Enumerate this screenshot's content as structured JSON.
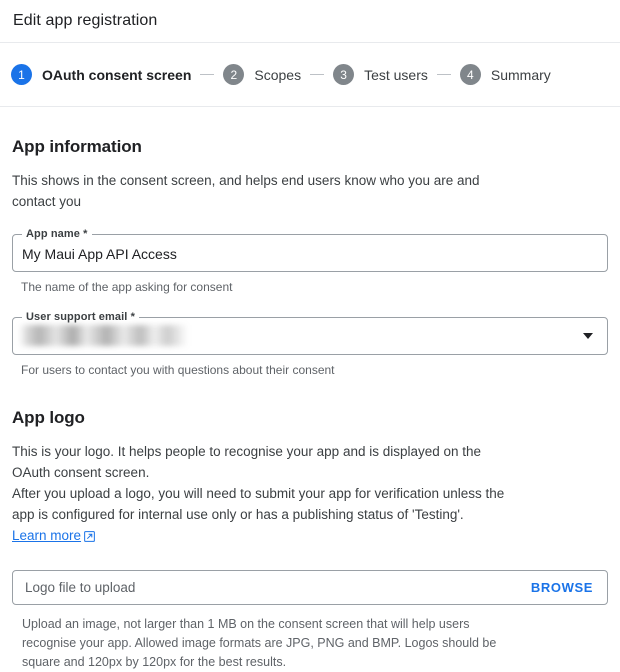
{
  "header": {
    "title": "Edit app registration"
  },
  "stepper": {
    "steps": [
      {
        "num": "1",
        "label": "OAuth consent screen",
        "active": true
      },
      {
        "num": "2",
        "label": "Scopes",
        "active": false
      },
      {
        "num": "3",
        "label": "Test users",
        "active": false
      },
      {
        "num": "4",
        "label": "Summary",
        "active": false
      }
    ]
  },
  "app_information": {
    "heading": "App information",
    "description": "This shows in the consent screen, and helps end users know who you are and contact you",
    "app_name": {
      "label": "App name *",
      "value": "My Maui App API Access",
      "hint": "The name of the app asking for consent"
    },
    "user_support_email": {
      "label": "User support email *",
      "value": "",
      "hint": "For users to contact you with questions about their consent"
    }
  },
  "app_logo": {
    "heading": "App logo",
    "description_1": "This is your logo. It helps people to recognise your app and is displayed on the OAuth consent screen.",
    "description_2_before_link": "After you upload a logo, you will need to submit your app for verification unless the app is configured for internal use only or has a publishing status of 'Testing'. ",
    "learn_more_label": "Learn more",
    "upload": {
      "placeholder": "Logo file to upload",
      "browse_label": "BROWSE",
      "hint": "Upload an image, not larger than 1 MB on the consent screen that will help users recognise your app. Allowed image formats are JPG, PNG and BMP. Logos should be square and 120px by 120px for the best results."
    }
  },
  "colors": {
    "accent": "#1a73e8",
    "step_inactive": "#80868b",
    "border": "#9aa0a6",
    "divider": "#e8eaed",
    "text_primary": "#202124",
    "text_secondary": "#5f6368"
  }
}
